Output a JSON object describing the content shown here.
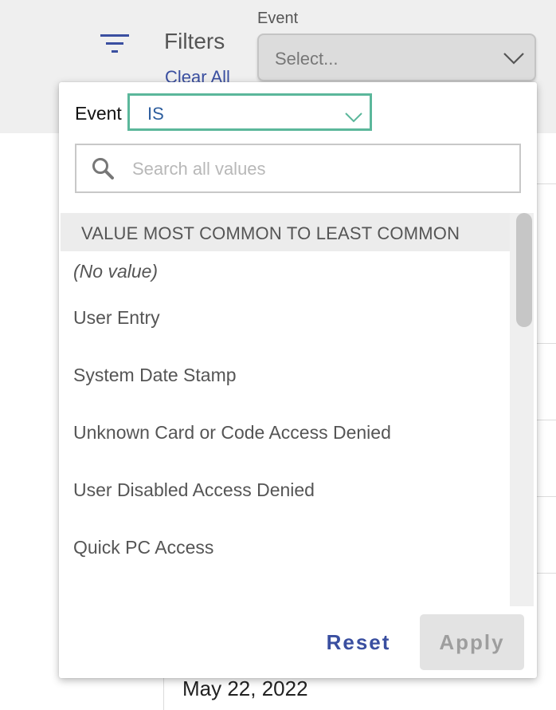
{
  "header": {
    "filters_title": "Filters",
    "clear_all_label": "Clear All",
    "event_field_label": "Event",
    "event_select_placeholder": "Select..."
  },
  "background": {
    "date_text": "May 22, 2022"
  },
  "panel": {
    "condition_label": "Event",
    "condition_value": "IS",
    "search_placeholder": "Search all values",
    "list_header": "VALUE MOST COMMON TO LEAST COMMON",
    "values": [
      "(No value)",
      "User Entry",
      "System Date Stamp",
      "Unknown Card or Code Access Denied",
      "User Disabled Access Denied",
      "Quick PC Access"
    ],
    "reset_label": "Reset",
    "apply_label": "Apply"
  },
  "colors": {
    "accent_blue": "#3a4fa0",
    "condition_border": "#5bb79b",
    "panel_bg": "#ffffff",
    "topbar_bg": "#efefef"
  },
  "icons": [
    "filter-icon",
    "chevron-down-icon",
    "search-icon"
  ]
}
